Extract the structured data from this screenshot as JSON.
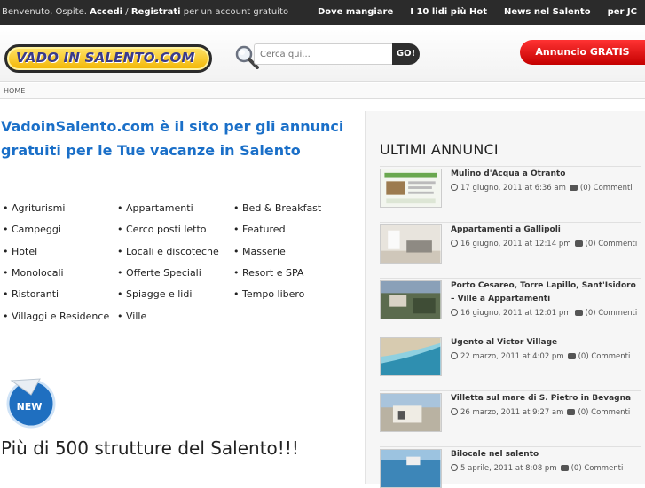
{
  "topbar": {
    "welcome_prefix": "Benvenuto, Ospite.",
    "login": "Accedi",
    "slash": " / ",
    "register": "Registrati",
    "welcome_suffix": "per un account gratuito",
    "nav": [
      "Dove mangiare",
      "I 10 lidi più Hot",
      "News nel Salento",
      "per JC"
    ]
  },
  "header": {
    "logo_text": "VADO IN SALENTO.COM",
    "search_placeholder": "Cerca qui...",
    "search_button": "GO!",
    "cta": "Annuncio GRATIS"
  },
  "breadcrumb": "HOME",
  "main": {
    "headline": "VadoinSalento.com è il sito per gli annunci gratuiti per le Tue vacanze in Salento",
    "categories": [
      [
        "Agriturismi",
        "Appartamenti",
        "Bed & Breakfast"
      ],
      [
        "Campeggi",
        "Cerco posti letto",
        "Featured"
      ],
      [
        "Hotel",
        "Locali e discoteche",
        "Masserie"
      ],
      [
        "Monolocali",
        "Offerte Speciali",
        "Resort e SPA"
      ],
      [
        "Ristoranti",
        "Spiagge e lidi",
        "Tempo libero"
      ],
      [
        "Villaggi e Residence",
        "Ville",
        ""
      ]
    ],
    "badge": "NEW",
    "count_line": "Più di 500 strutture del Salento!!!"
  },
  "sidebar": {
    "title": "ULTIMI ANNUNCI",
    "posts": [
      {
        "title": "Mulino d'Acqua a Otranto",
        "date": "17 giugno, 2011 at 6:36 am",
        "comments": "(0) Commenti"
      },
      {
        "title": "Appartamenti a Gallipoli",
        "date": "16 giugno, 2011 at 12:14 pm",
        "comments": "(0) Commenti"
      },
      {
        "title": "Porto Cesareo, Torre Lapillo, Sant'Isidoro – Ville a Appartamenti",
        "date": "16 giugno, 2011 at 12:01 pm",
        "comments": "(0) Commenti"
      },
      {
        "title": "Ugento al Victor Village",
        "date": "22 marzo, 2011 at 4:02 pm",
        "comments": "(0) Commenti"
      },
      {
        "title": "Villetta sul mare di S. Pietro in Bevagna",
        "date": "26 marzo, 2011 at 9:27 am",
        "comments": "(0) Commenti"
      },
      {
        "title": "Bilocale nel salento",
        "date": "5 aprile, 2011 at 8:08 pm",
        "comments": "(0) Commenti"
      }
    ]
  },
  "colors": {
    "topbar": "#2b2b2b",
    "headline": "#1a6fc8",
    "cta": "#e00000",
    "logo": "#f2b500"
  }
}
